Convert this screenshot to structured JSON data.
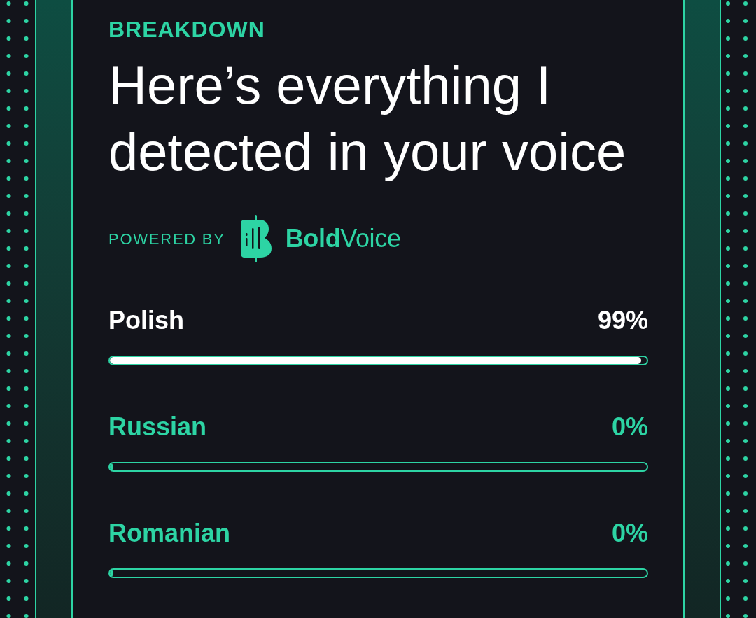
{
  "eyebrow": "BREAKDOWN",
  "heading": "Here’s everything I detected in your voice",
  "powered_by": {
    "label": "POWERED BY",
    "brand": "**Bold**Voice"
  },
  "results": [
    {
      "language": "Polish",
      "percent": "99%",
      "level": 0.99,
      "highlighted": true
    },
    {
      "language": "Russian",
      "percent": "0%",
      "level": 0,
      "highlighted": false
    },
    {
      "language": "Romanian",
      "percent": "0%",
      "level": 0,
      "highlighted": false
    }
  ]
}
